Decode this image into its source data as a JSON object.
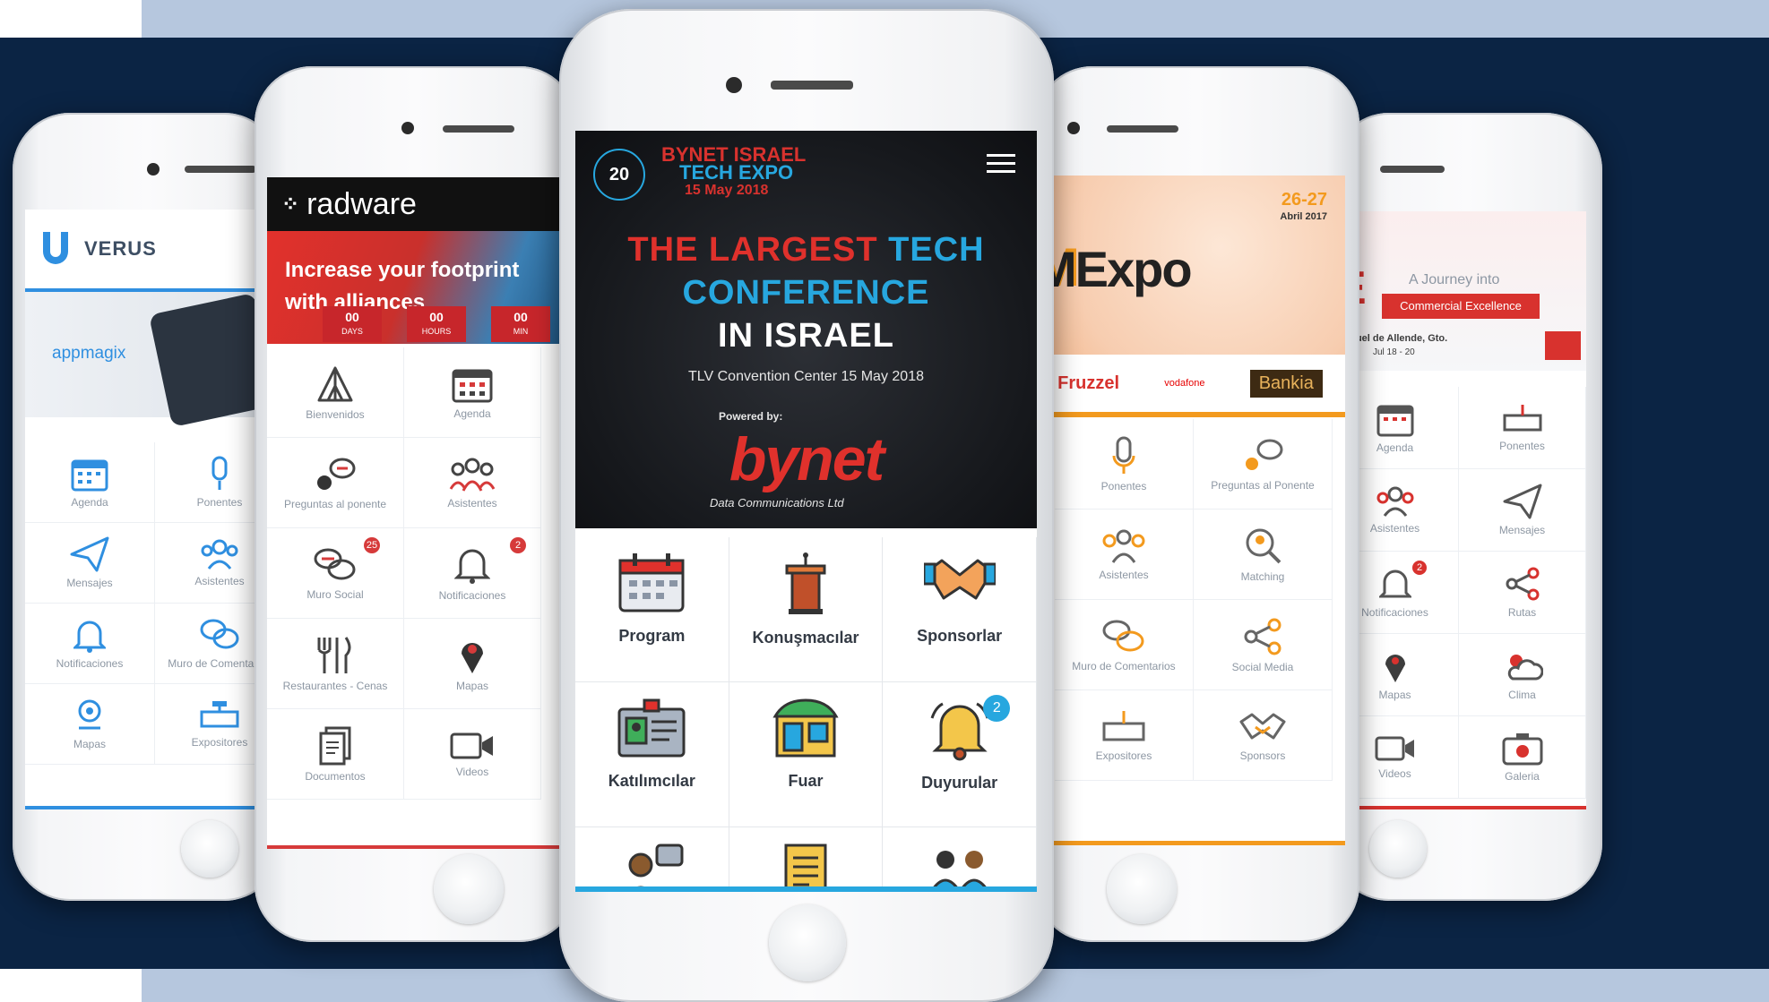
{
  "phones": {
    "verus": {
      "brand": "VERUS",
      "banner_brand": "appmagix",
      "items": [
        {
          "label": "Agenda",
          "icon": "calendar-icon"
        },
        {
          "label": "Ponentes",
          "icon": "microphone-icon"
        },
        {
          "label": "Mensajes",
          "icon": "paper-plane-icon"
        },
        {
          "label": "Asistentes",
          "icon": "people-icon"
        },
        {
          "label": "Notificaciones",
          "icon": "bell-icon"
        },
        {
          "label": "Muro de Comentarios",
          "icon": "chat-bubbles-icon"
        },
        {
          "label": "Mapas",
          "icon": "map-pin-icon"
        },
        {
          "label": "Expositores",
          "icon": "booth-icon"
        }
      ],
      "accent": "#2f8fe0"
    },
    "radware": {
      "brand": "radware",
      "banner_text": "Increase your footprint with alliances",
      "countdown": [
        {
          "value": "00",
          "unit": "DAYS"
        },
        {
          "value": "00",
          "unit": "HOURS"
        },
        {
          "value": "00",
          "unit": "MIN"
        }
      ],
      "items": [
        {
          "label": "Bienvenidos",
          "icon": "tent-icon"
        },
        {
          "label": "Agenda",
          "icon": "calendar-icon"
        },
        {
          "label": "Preguntas al ponente",
          "icon": "question-chat-icon"
        },
        {
          "label": "Asistentes",
          "icon": "people-icon"
        },
        {
          "label": "Muro Social",
          "icon": "chat-bubbles-icon",
          "badge": "25"
        },
        {
          "label": "Notificaciones",
          "icon": "bell-icon",
          "badge": "2"
        },
        {
          "label": "Restaurantes - Cenas",
          "icon": "cutlery-icon"
        },
        {
          "label": "Mapas",
          "icon": "map-pin-icon"
        },
        {
          "label": "Documentos",
          "icon": "document-icon"
        },
        {
          "label": "Videos",
          "icon": "video-camera-icon"
        }
      ],
      "accent": "#d63a3a"
    },
    "bynet": {
      "logo_line1": "BYNET ISRAEL",
      "logo_line2": "TECH EXPO",
      "logo_date": "15 May 2018",
      "hero_line1a": "THE LARGEST",
      "hero_line1b": "TECH",
      "hero_line2": "CONFERENCE",
      "hero_line3": "IN ISRAEL",
      "venue": "TLV Convention Center 15 May 2018",
      "powered_by": "Powered by:",
      "sponsor": "bynet",
      "sponsor_tag": "Data Communications Ltd",
      "items": [
        {
          "label": "Program",
          "icon": "calendar-icon"
        },
        {
          "label": "Konuşmacılar",
          "icon": "podium-icon"
        },
        {
          "label": "Sponsorlar",
          "icon": "handshake-icon"
        },
        {
          "label": "Katılımcılar",
          "icon": "id-badge-icon"
        },
        {
          "label": "Fuar",
          "icon": "booth-icon"
        },
        {
          "label": "Duyurular",
          "icon": "bell-icon",
          "badge": "2"
        },
        {
          "label": "",
          "icon": "person-chat-icon"
        },
        {
          "label": "",
          "icon": "document-icon"
        },
        {
          "label": "",
          "icon": "meeting-icon"
        }
      ],
      "accent": "#27a7df"
    },
    "omexpo": {
      "brand": "MExpo",
      "dates": "26-27",
      "month": "Abril 2017",
      "sponsors": [
        "Fruzzel",
        "vodafone",
        "Bankia"
      ],
      "items": [
        {
          "label": "Ponentes",
          "icon": "microphone-icon"
        },
        {
          "label": "Preguntas al Ponente",
          "icon": "question-chat-icon"
        },
        {
          "label": "Asistentes",
          "icon": "people-icon"
        },
        {
          "label": "Matching",
          "icon": "search-person-icon"
        },
        {
          "label": "Muro de Comentarios",
          "icon": "chat-bubbles-icon"
        },
        {
          "label": "Social Media",
          "icon": "share-icon"
        },
        {
          "label": "Expositores",
          "icon": "booth-icon"
        },
        {
          "label": "Sponsors",
          "icon": "handshake-icon"
        }
      ],
      "accent": "#f39a1e"
    },
    "commercial": {
      "header_left": "E",
      "tagline": "A Journey into",
      "banner_cta": "Commercial Excellence",
      "location": "Miguel de Allende, Gto.",
      "dates": "Jul 18 - 20",
      "items": [
        {
          "label": "Agenda",
          "icon": "calendar-icon"
        },
        {
          "label": "Ponentes",
          "icon": "booth-icon"
        },
        {
          "label": "Asistentes",
          "icon": "people-icon"
        },
        {
          "label": "Mensajes",
          "icon": "paper-plane-icon"
        },
        {
          "label": "Notificaciones",
          "icon": "bell-icon",
          "badge": "2"
        },
        {
          "label": "Rutas",
          "icon": "share-icon"
        },
        {
          "label": "Mapas",
          "icon": "map-pin-icon"
        },
        {
          "label": "Clima",
          "icon": "weather-icon"
        },
        {
          "label": "Videos",
          "icon": "video-camera-icon"
        },
        {
          "label": "Galeria",
          "icon": "camera-icon"
        }
      ],
      "accent": "#d8322e"
    }
  }
}
